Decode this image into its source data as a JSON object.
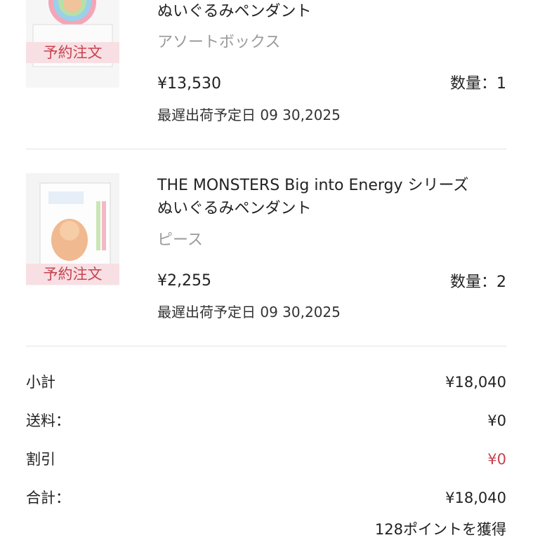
{
  "items": [
    {
      "title_line2": "ぬいぐるみペンダント",
      "variant": "アソートボックス",
      "price": "¥13,530",
      "quantity": "数量：1",
      "ship_date": "最遅出荷予定日 09 30,2025",
      "badge": "予約注文"
    },
    {
      "title_line1": "THE MONSTERS Big into Energy シリーズ",
      "title_line2": "ぬいぐるみペンダント",
      "variant": "ピース",
      "price": "¥2,255",
      "quantity": "数量：2",
      "ship_date": "最遅出荷予定日 09 30,2025",
      "badge": "予約注文"
    }
  ],
  "summary": {
    "subtotal_label": "小計",
    "subtotal_value": "¥18,040",
    "shipping_label": "送料：",
    "shipping_value": "¥0",
    "discount_label": "割引",
    "discount_value": "¥0",
    "total_label": "合計：",
    "total_value": "¥18,040",
    "points": "128ポイントを獲得"
  },
  "colors": {
    "badge_bg": "#f8dfe3",
    "badge_text": "#c8424f",
    "discount_text": "#c8424f"
  }
}
